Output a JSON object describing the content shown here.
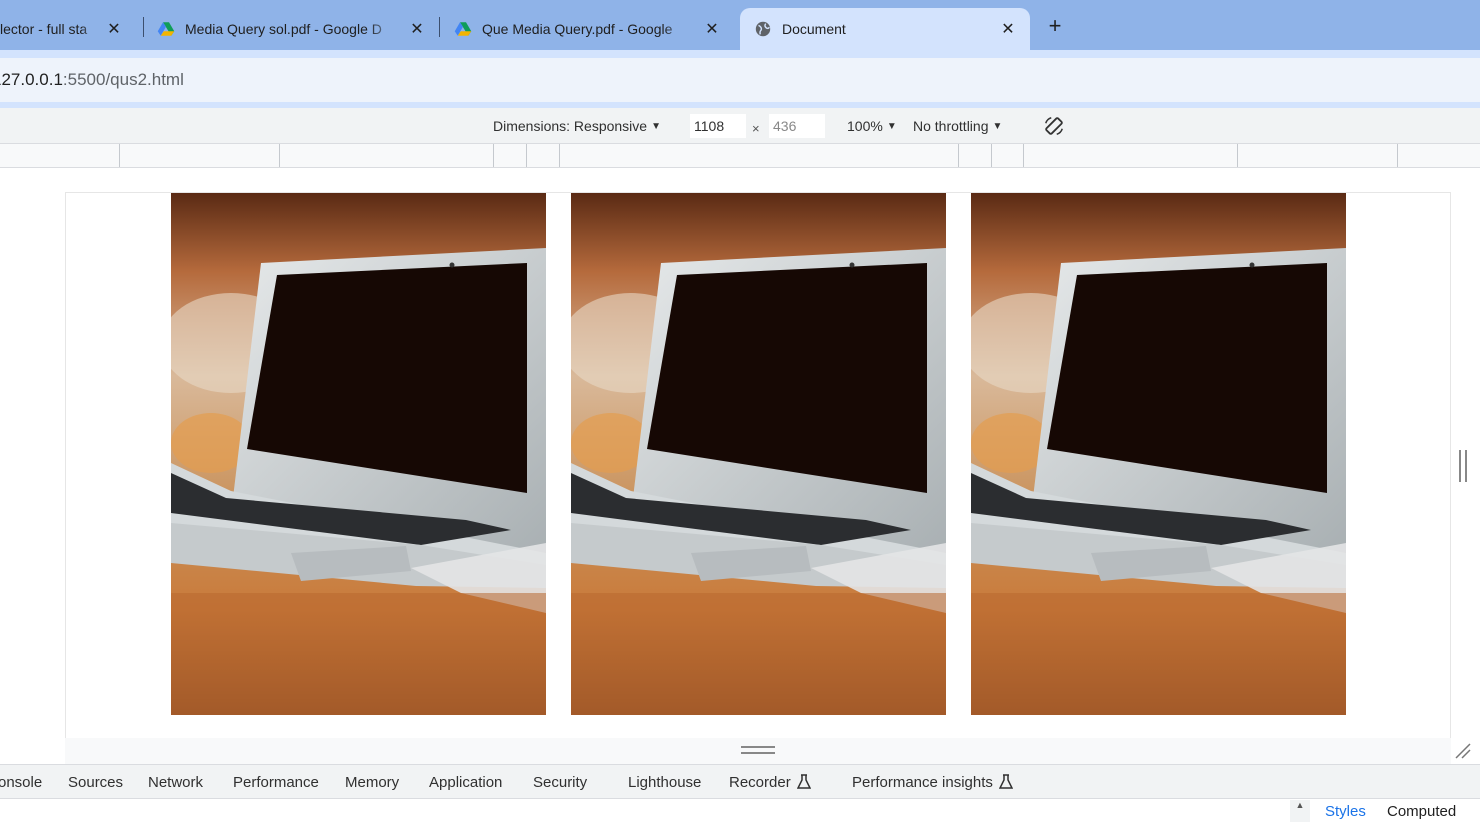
{
  "tabs": [
    {
      "title": "lector - full sta",
      "favicon": "none",
      "active": false
    },
    {
      "title": "Media Query sol.pdf - Google D",
      "favicon": "google-drive",
      "active": false
    },
    {
      "title": "Que Media Query.pdf - Google",
      "favicon": "google-drive",
      "active": false
    },
    {
      "title": "Document",
      "favicon": "globe",
      "active": true
    }
  ],
  "address": {
    "host": "127.0.0.1",
    "path": ":5500/qus2.html"
  },
  "device_toolbar": {
    "dimensions_label": "Dimensions: Responsive",
    "width": "1108",
    "times": "×",
    "height": "436",
    "zoom": "100%",
    "throttling": "No throttling"
  },
  "devtools_tabs": [
    "onsole",
    "Sources",
    "Network",
    "Performance",
    "Memory",
    "Application",
    "Security",
    "Lighthouse",
    "Recorder",
    "Performance insights"
  ],
  "styles_tabs": {
    "styles": "Styles",
    "computed": "Computed"
  },
  "colors": {
    "tabstrip": "#8fb3e8",
    "active_tab": "#d3e3fd",
    "accent": "#1a73e8"
  },
  "page_images": [
    "laptop-photo",
    "laptop-photo",
    "laptop-photo"
  ]
}
